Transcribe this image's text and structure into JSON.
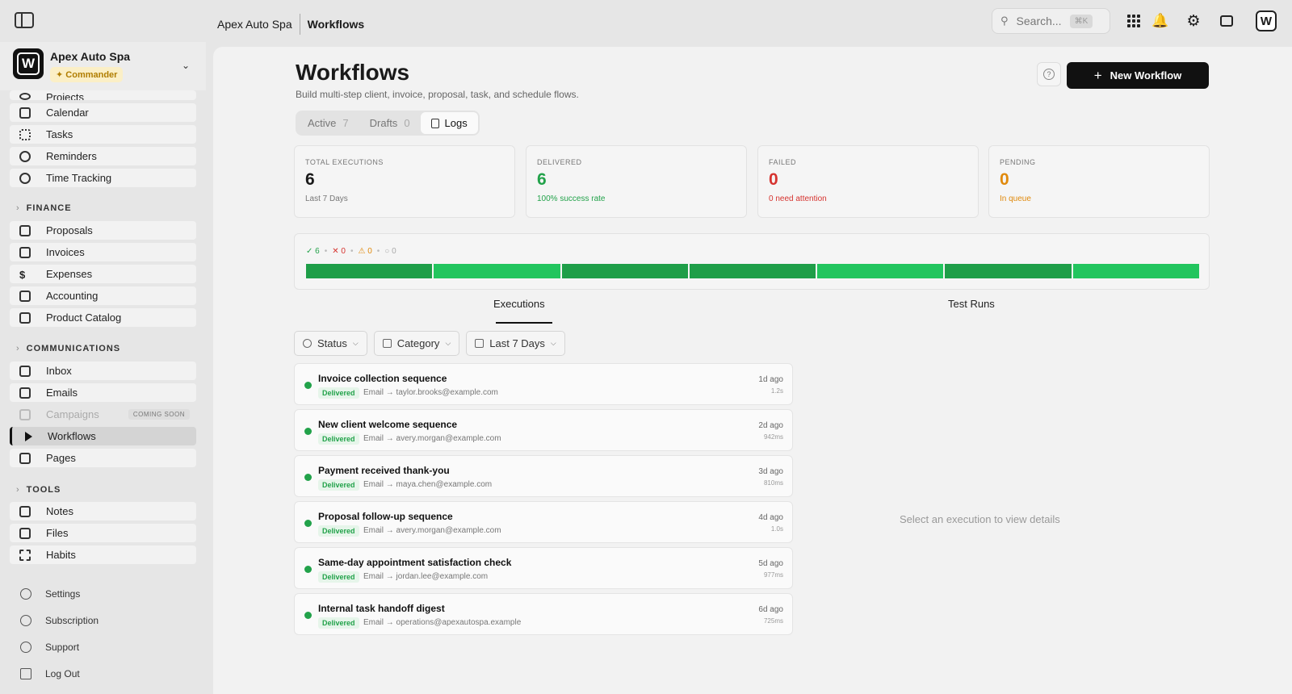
{
  "breadcrumb": {
    "org": "Apex Auto Spa",
    "page": "Workflows"
  },
  "topbar": {
    "search_placeholder": "Search...",
    "search_shortcut": "⌘K"
  },
  "workspace": {
    "logo_letter": "W",
    "name": "Apex Auto Spa",
    "role": "Commander"
  },
  "sidebar": {
    "top_items": [
      "Projects",
      "Calendar",
      "Tasks",
      "Reminders",
      "Time Tracking"
    ],
    "finance_label": "FINANCE",
    "finance_items": [
      "Proposals",
      "Invoices",
      "Expenses",
      "Accounting",
      "Product Catalog"
    ],
    "comms_label": "COMMUNICATIONS",
    "comms_items": [
      "Inbox",
      "Emails",
      "Campaigns",
      "Workflows",
      "Pages"
    ],
    "coming_soon": "COMING SOON",
    "tools_label": "TOOLS",
    "tools_items": [
      "Notes",
      "Files",
      "Habits"
    ],
    "footer_items": [
      "Settings",
      "Subscription",
      "Support",
      "Log Out"
    ]
  },
  "header": {
    "title": "Workflows",
    "subtitle": "Build multi-step client, invoice, proposal, task, and schedule flows.",
    "help": "?",
    "new_button": "New Workflow"
  },
  "segments": [
    {
      "label": "Active",
      "count": "7"
    },
    {
      "label": "Drafts",
      "count": "0"
    },
    {
      "label": "Logs",
      "count": ""
    }
  ],
  "stats": [
    {
      "label": "TOTAL EXECUTIONS",
      "value": "6",
      "note": "Last 7 Days",
      "color": "#1a1a1a",
      "note_color": "#777777"
    },
    {
      "label": "DELIVERED",
      "value": "6",
      "note": "100% success rate",
      "color": "#22a24a",
      "note_color": "#22a24a"
    },
    {
      "label": "FAILED",
      "value": "0",
      "note": "0 need attention",
      "color": "#d6332f",
      "note_color": "#d6332f"
    },
    {
      "label": "PENDING",
      "value": "0",
      "note": "In queue",
      "color": "#e0890b",
      "note_color": "#e0890b"
    }
  ],
  "timeline": {
    "legend": {
      "ok": "✓ 6",
      "fail": "✕ 0",
      "warn": "⚠ 0",
      "pending": "○ 0"
    },
    "bars": [
      "#1e9e48",
      "#22c55e",
      "#1e9e48",
      "#1e9e48",
      "#22c55e",
      "#1e9e48",
      "#22c55e"
    ]
  },
  "tabs": [
    "Executions",
    "Test Runs"
  ],
  "filters": [
    "Status",
    "Category",
    "Last 7 Days"
  ],
  "executions": [
    {
      "name": "Invoice collection sequence",
      "status": "Delivered",
      "meta": "Email → taylor.brooks@example.com",
      "ago": "1d ago",
      "duration": "1.2s"
    },
    {
      "name": "New client welcome sequence",
      "status": "Delivered",
      "meta": "Email → avery.morgan@example.com",
      "ago": "2d ago",
      "duration": "942ms"
    },
    {
      "name": "Payment received thank-you",
      "status": "Delivered",
      "meta": "Email → maya.chen@example.com",
      "ago": "3d ago",
      "duration": "810ms"
    },
    {
      "name": "Proposal follow-up sequence",
      "status": "Delivered",
      "meta": "Email → avery.morgan@example.com",
      "ago": "4d ago",
      "duration": "1.0s"
    },
    {
      "name": "Same-day appointment satisfaction check",
      "status": "Delivered",
      "meta": "Email → jordan.lee@example.com",
      "ago": "5d ago",
      "duration": "977ms"
    },
    {
      "name": "Internal task handoff digest",
      "status": "Delivered",
      "meta": "Email → operations@apexautospa.example",
      "ago": "6d ago",
      "duration": "725ms"
    }
  ],
  "detail": {
    "empty_text": "Select an execution to view details"
  }
}
